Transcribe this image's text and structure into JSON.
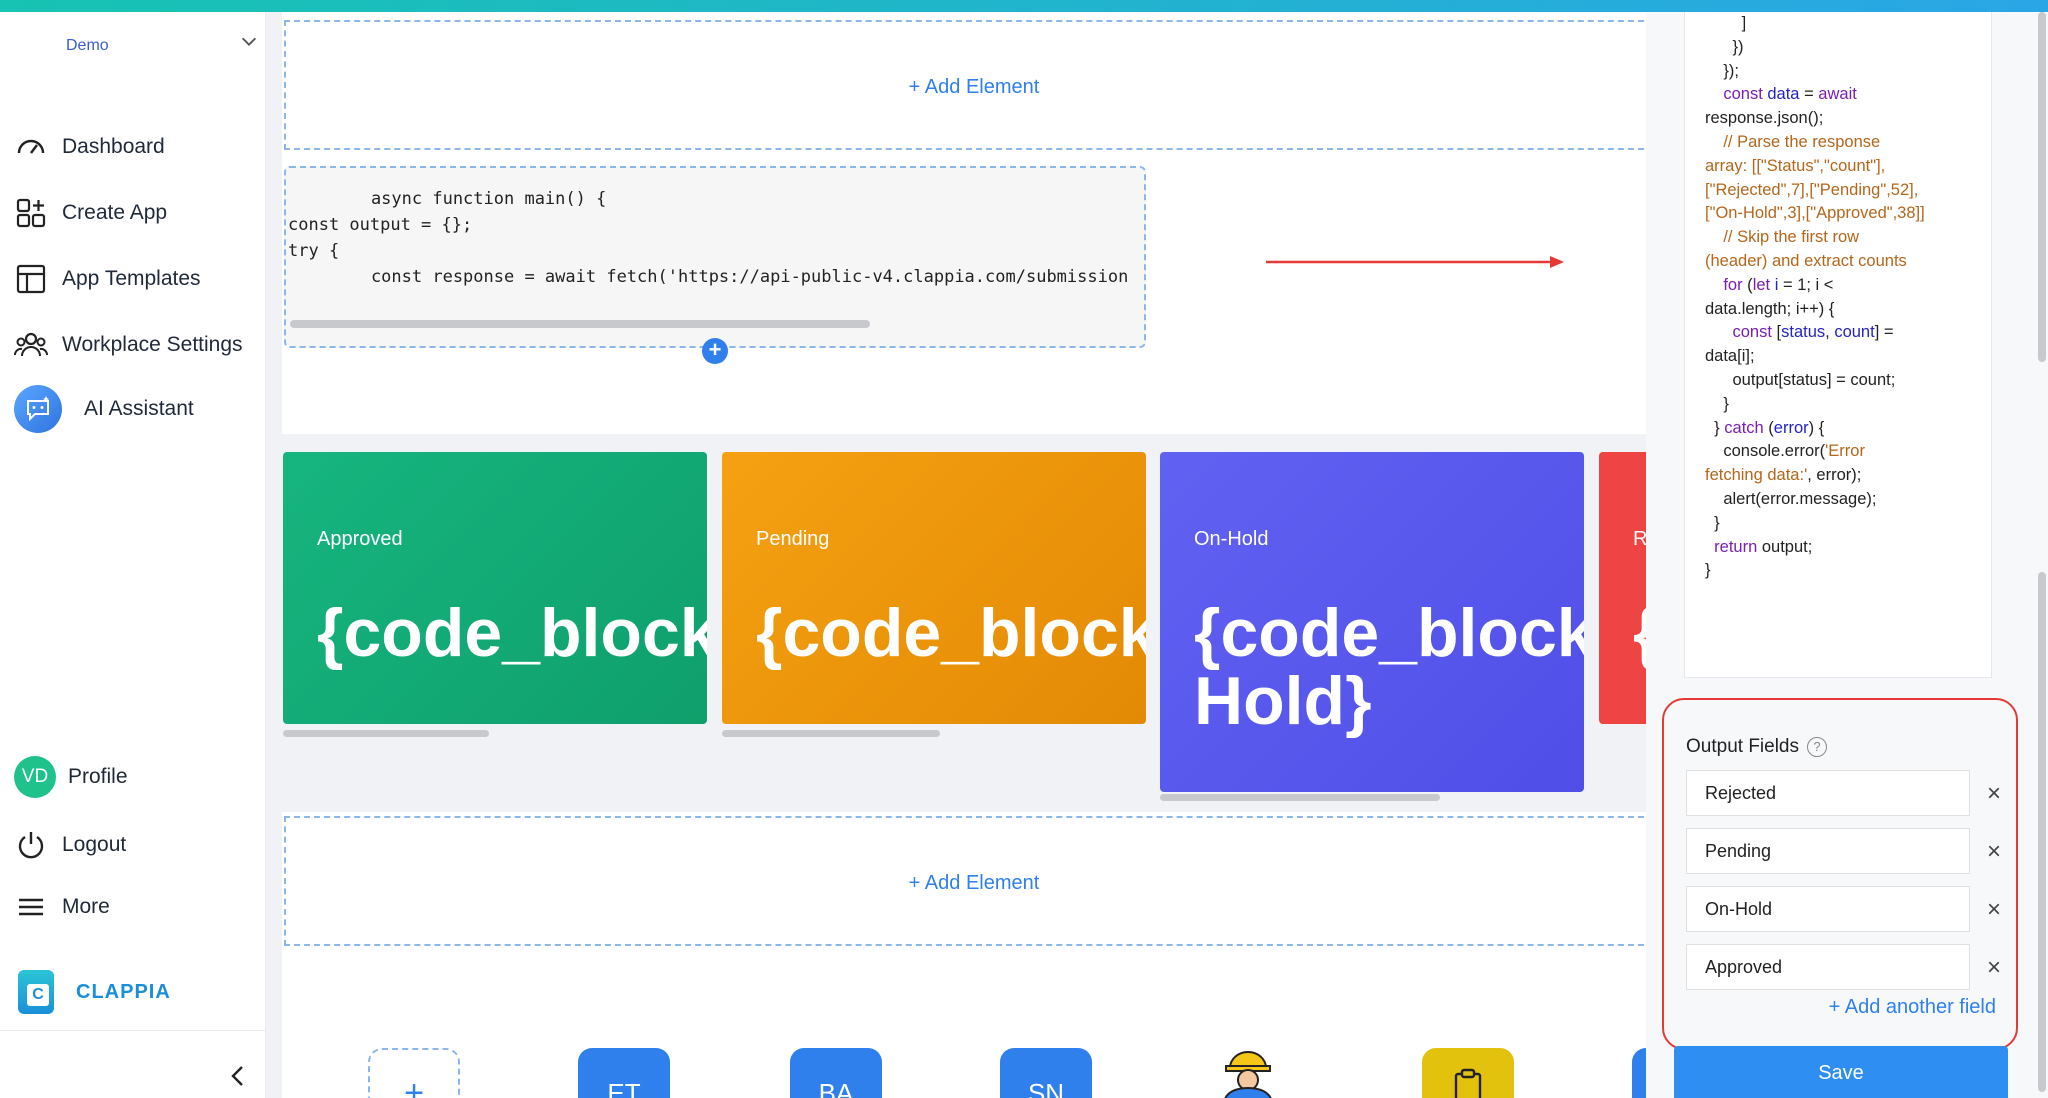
{
  "sidebar": {
    "workspace": "Demo",
    "items": [
      {
        "label": "Dashboard"
      },
      {
        "label": "Create App"
      },
      {
        "label": "App Templates"
      },
      {
        "label": "Workplace Settings"
      },
      {
        "label": "AI Assistant"
      }
    ],
    "profile": {
      "initials": "VD",
      "label": "Profile"
    },
    "logout": "Logout",
    "more": "More",
    "brand": "CLAPPIA"
  },
  "canvas": {
    "add_element_top": "+ Add Element",
    "add_element_bottom": "+ Add Element",
    "code_lines": [
      "    async function main() {",
      "const output = {};",
      "",
      "try {",
      "    const response = await fetch('https://api-public-v4.clappia.com/submission"
    ],
    "cards": [
      {
        "label": "Approved",
        "value": "{code_block",
        "color": "#14b07a"
      },
      {
        "label": "Pending",
        "value": "{code_block",
        "color": "#f29c12"
      },
      {
        "label": "On-Hold",
        "value": "{code_block",
        "value2": "Hold}",
        "color": "#5a5af0"
      },
      {
        "label": "Re",
        "value": "{",
        "color": "#ef4444"
      }
    ],
    "app_tiles": [
      {
        "label": "+"
      },
      {
        "label": "ET",
        "color": "#2f80ed"
      },
      {
        "label": "BA",
        "color": "#2f80ed"
      },
      {
        "label": "SN",
        "color": "#2f80ed"
      }
    ]
  },
  "code_panel": {
    "lines": [
      "        ]",
      "      })",
      "    });",
      "",
      "    const data = await",
      "response.json();",
      "",
      "    // Parse the response",
      "array: [[\"Status\",\"count\"],",
      "[\"Rejected\",7],[\"Pending\",52],",
      "[\"On-Hold\",3],[\"Approved\",38]]",
      "    // Skip the first row",
      "(header) and extract counts",
      "    for (let i = 1; i <",
      "data.length; i++) {",
      "      const [status, count] =",
      "data[i];",
      "      output[status] = count;",
      "    }",
      "",
      "  } catch (error) {",
      "    console.error('Error",
      "fetching data:', error);",
      "    alert(error.message);",
      "  }",
      "",
      "  return output;",
      "}"
    ]
  },
  "output_fields": {
    "title": "Output Fields",
    "help": "?",
    "fields": [
      "Rejected",
      "Pending",
      "On-Hold",
      "Approved"
    ],
    "add_label": "+ Add another field"
  },
  "save_label": "Save"
}
